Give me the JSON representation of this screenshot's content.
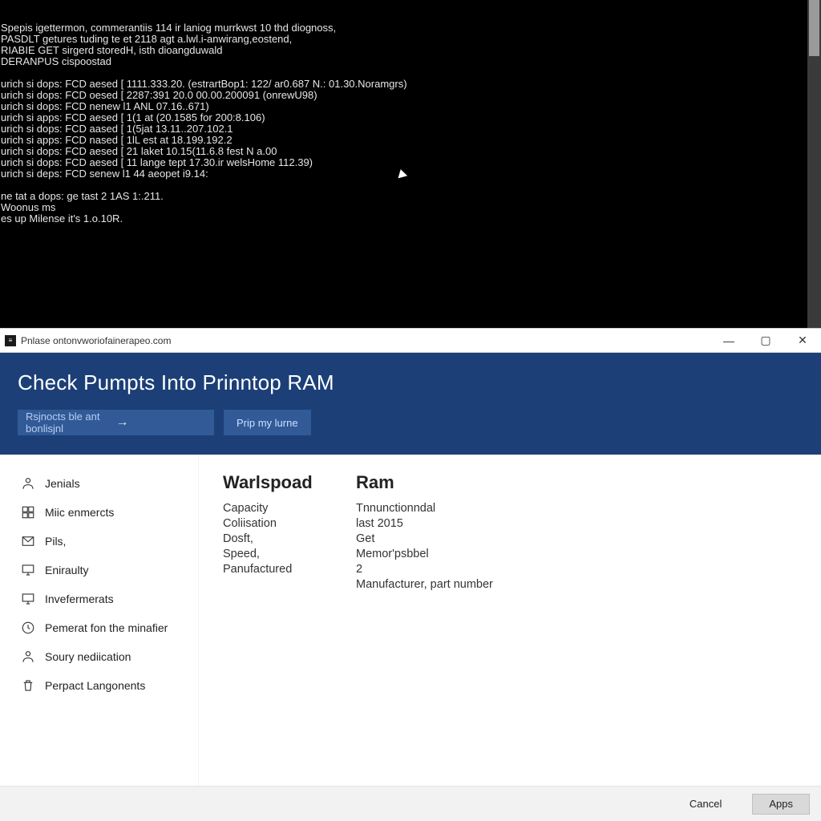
{
  "terminal": {
    "lines": [
      "Spepis igettermon, commerantiis 114 ir laniog murrkwst 10 thd diognoss,",
      "PASDLT getures tuding te et 2118 agt a.lwl.i-anwirang,eostend,",
      "RIABIE GET sirgerd storedH, isth dioangduwald",
      "DERANPUS cispoostad",
      "",
      "urich si dops: FCD aesed [ 1111.333.20. (estrartBop1: 122/ ar0.687 N.: 01.30.Noramgrs)",
      "urich si dops: FCD oesed [ 2287:391 20.0 00.00.200091 (onrewU98)",
      "urich si dops: FCD nenew l1 ANL 07.16..671)",
      "urich si apps: FCD aesed [ 1(1 at (20.1585 for 200:8.106)",
      "urich si dops: FCD aased [ 1(5jat 13.11..207.102.1",
      "urich si apps: FCD nased [ 1lL est at 18.199.192.2",
      "urich si dops: FCD aesed [ 21 laket 10.15(11.6.8 fest N a.00",
      "urich si dops: FCD aesed [ 11 lange tept 17.30.ir welsHome 112.39)",
      "urich si deps: FCD senew l1 44 aeopet i9.14:",
      "",
      "ne tat a dops: ge tast 2 1AS 1:.211.",
      "Woonus ms",
      "es up Milense it's 1.o.10R."
    ]
  },
  "window": {
    "titlebar": "Pnlase ontonvworiofainerapeo.com",
    "controls": {
      "min": "—",
      "max": "▢",
      "close": "✕"
    }
  },
  "header": {
    "title": "Check Pumpts Into Prinntop RAM",
    "search_placeholder": "Rsjnocts ble ant bonlisjnl",
    "search_arrow": "→",
    "help_label": "Prip my lurne"
  },
  "sidebar": {
    "items": [
      {
        "label": "Jenials"
      },
      {
        "label": "Miic enmercts"
      },
      {
        "label": "Pils,"
      },
      {
        "label": "Eniraulty"
      },
      {
        "label": "Invefermerats"
      },
      {
        "label": "Pemerat fon the minafier"
      },
      {
        "label": "Soury nediication"
      },
      {
        "label": "Perpact Langonents"
      }
    ]
  },
  "main": {
    "left_heading": "Warlspoad",
    "right_heading": "Ram",
    "rows": [
      {
        "l": "Capacity",
        "r": "Tnnunctionndal"
      },
      {
        "l": "",
        "r": "last 2015"
      },
      {
        "l": "Coliisation",
        "r": "Get"
      },
      {
        "l": "Dosft,",
        "r": "Memor'psbbel"
      },
      {
        "l": "Speed,",
        "r": "2"
      },
      {
        "l": "Panufactured",
        "r": "Manufacturer, part number"
      }
    ]
  },
  "footer": {
    "cancel": "Cancel",
    "apps": "Apps"
  }
}
